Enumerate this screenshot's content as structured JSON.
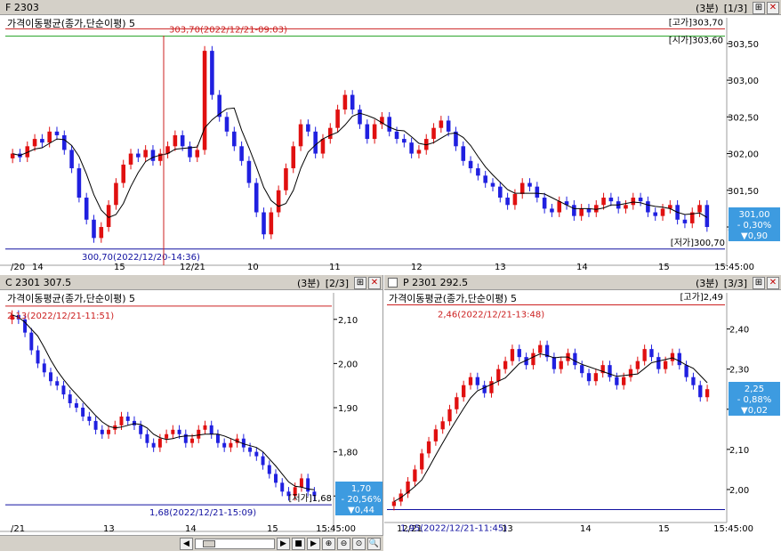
{
  "colors": {
    "up": "#e01010",
    "down": "#2020e0",
    "ma": "#000000",
    "high_line": "#cc2020",
    "low_line": "#1010a0",
    "open_line": "#20a020",
    "badge_bg": "#3d9be0",
    "titlebar": "#d4d0c8"
  },
  "panels": [
    {
      "symbol": "F 2303",
      "interval": "(3분)",
      "page": "[1/3]",
      "ma_label": "가격이동평균(종가,단순이평) 5",
      "price_labels": [
        "303,50",
        "303,00",
        "302,50",
        "302,00",
        "301,50",
        "301,00"
      ],
      "high_annotation": "303,70(2022/12/21-09:03)",
      "low_annotation": "300,70(2022/12/20-14:36)",
      "high_tag": "[고가]303,70",
      "open_tag": "[시가]303,60",
      "low_tag": "[저가]300,70",
      "badge": {
        "price": "301,00",
        "pct": "- 0,30%",
        "chg": "▼0,90"
      },
      "x_labels": [
        "/20",
        "14",
        "15",
        "12/21",
        "10",
        "11",
        "12",
        "13",
        "14",
        "15",
        "15:45:00"
      ],
      "buttons": {
        "restore": "⊞",
        "close": "✕"
      }
    },
    {
      "symbol": "C 2301  307.5",
      "interval": "(3분)",
      "page": "[2/3]",
      "ma_label": "가격이동평균(종가,단순이평) 5",
      "price_labels": [
        "2,10",
        "2,00",
        "1,90",
        "1,80",
        "1,70"
      ],
      "high_annotation": "2,13(2022/12/21-11:51)",
      "low_annotation": "1,68(2022/12/21-15:09)",
      "low_tag": "[저가]1,68",
      "badge": {
        "price": "1,70",
        "pct": "- 20,56%",
        "chg": "▼0,44"
      },
      "x_labels": [
        "/21",
        "13",
        "14",
        "15",
        "15:45:00"
      ],
      "buttons": {
        "restore": "⊞",
        "close": "✕"
      }
    },
    {
      "symbol": "P 2301  292.5",
      "interval": "(3분)",
      "page": "[3/3]",
      "ma_label": "가격이동평균(종가,단순이평) 5",
      "price_labels": [
        "2,40",
        "2,30",
        "2,20",
        "2,10",
        "2,00"
      ],
      "high_annotation": "2,46(2022/12/21-13:48)",
      "low_annotation": "1,95(2022/12/21-11:45)",
      "high_tag": "[고가]2,49",
      "badge": {
        "price": "2,25",
        "pct": "- 0,88%",
        "chg": "▼0,02"
      },
      "x_labels": [
        "12/21",
        "13",
        "14",
        "15",
        "15:45:00"
      ],
      "buttons": {
        "restore": "⊞",
        "close": "✕"
      }
    }
  ],
  "scrollbar": {
    "left": "◀",
    "right": "▶",
    "stop": "■",
    "play": "▶",
    "zoom_in": "⊕",
    "zoom_out": "⊖",
    "zoom_reset": "⊙",
    "search": "🔍"
  },
  "chart_data": [
    {
      "type": "candlestick",
      "title": "F 2303",
      "ylim": [
        300.6,
        303.85
      ],
      "high": 303.7,
      "low": 300.7,
      "open": 303.6,
      "last": 301.0,
      "closes": [
        302.0,
        301.95,
        302.1,
        302.2,
        302.15,
        302.3,
        302.25,
        302.05,
        301.8,
        301.4,
        301.1,
        300.85,
        301.0,
        301.3,
        301.6,
        301.85,
        302.0,
        301.95,
        302.05,
        301.9,
        302.0,
        302.1,
        302.25,
        302.1,
        301.95,
        302.05,
        303.4,
        302.8,
        302.5,
        302.3,
        302.1,
        301.9,
        301.6,
        301.2,
        300.9,
        301.2,
        301.5,
        301.8,
        302.1,
        302.4,
        302.3,
        302.0,
        302.2,
        302.35,
        302.6,
        302.8,
        302.6,
        302.4,
        302.2,
        302.4,
        302.5,
        302.3,
        302.2,
        302.15,
        302.0,
        302.05,
        302.2,
        302.35,
        302.45,
        302.3,
        302.1,
        301.9,
        301.8,
        301.7,
        301.6,
        301.55,
        301.4,
        301.3,
        301.45,
        301.6,
        301.55,
        301.4,
        301.25,
        301.2,
        301.35,
        301.3,
        301.15,
        301.25,
        301.2,
        301.3,
        301.4,
        301.35,
        301.25,
        301.3,
        301.4,
        301.35,
        301.2,
        301.15,
        301.25,
        301.3,
        301.1,
        301.05,
        301.2,
        301.3,
        301.0
      ]
    },
    {
      "type": "candlestick",
      "title": "C 2301 307.5",
      "ylim": [
        1.64,
        2.16
      ],
      "high": 2.13,
      "low": 1.68,
      "last": 1.7,
      "closes": [
        2.11,
        2.1,
        2.07,
        2.03,
        2.0,
        1.98,
        1.96,
        1.95,
        1.93,
        1.91,
        1.9,
        1.88,
        1.87,
        1.85,
        1.84,
        1.85,
        1.86,
        1.88,
        1.87,
        1.86,
        1.84,
        1.82,
        1.81,
        1.83,
        1.84,
        1.85,
        1.84,
        1.82,
        1.83,
        1.85,
        1.86,
        1.84,
        1.82,
        1.81,
        1.82,
        1.83,
        1.81,
        1.8,
        1.79,
        1.77,
        1.75,
        1.73,
        1.71,
        1.7,
        1.72,
        1.74,
        1.71,
        1.7
      ]
    },
    {
      "type": "candlestick",
      "title": "P 2301 292.5",
      "ylim": [
        1.94,
        2.49
      ],
      "high": 2.46,
      "low": 1.95,
      "last": 2.25,
      "closes": [
        1.97,
        1.99,
        2.02,
        2.05,
        2.09,
        2.12,
        2.15,
        2.17,
        2.2,
        2.23,
        2.26,
        2.28,
        2.26,
        2.24,
        2.27,
        2.3,
        2.32,
        2.35,
        2.33,
        2.31,
        2.34,
        2.36,
        2.33,
        2.3,
        2.32,
        2.34,
        2.31,
        2.29,
        2.27,
        2.29,
        2.31,
        2.28,
        2.26,
        2.28,
        2.3,
        2.32,
        2.35,
        2.33,
        2.3,
        2.32,
        2.34,
        2.31,
        2.28,
        2.26,
        2.23,
        2.25
      ]
    }
  ]
}
